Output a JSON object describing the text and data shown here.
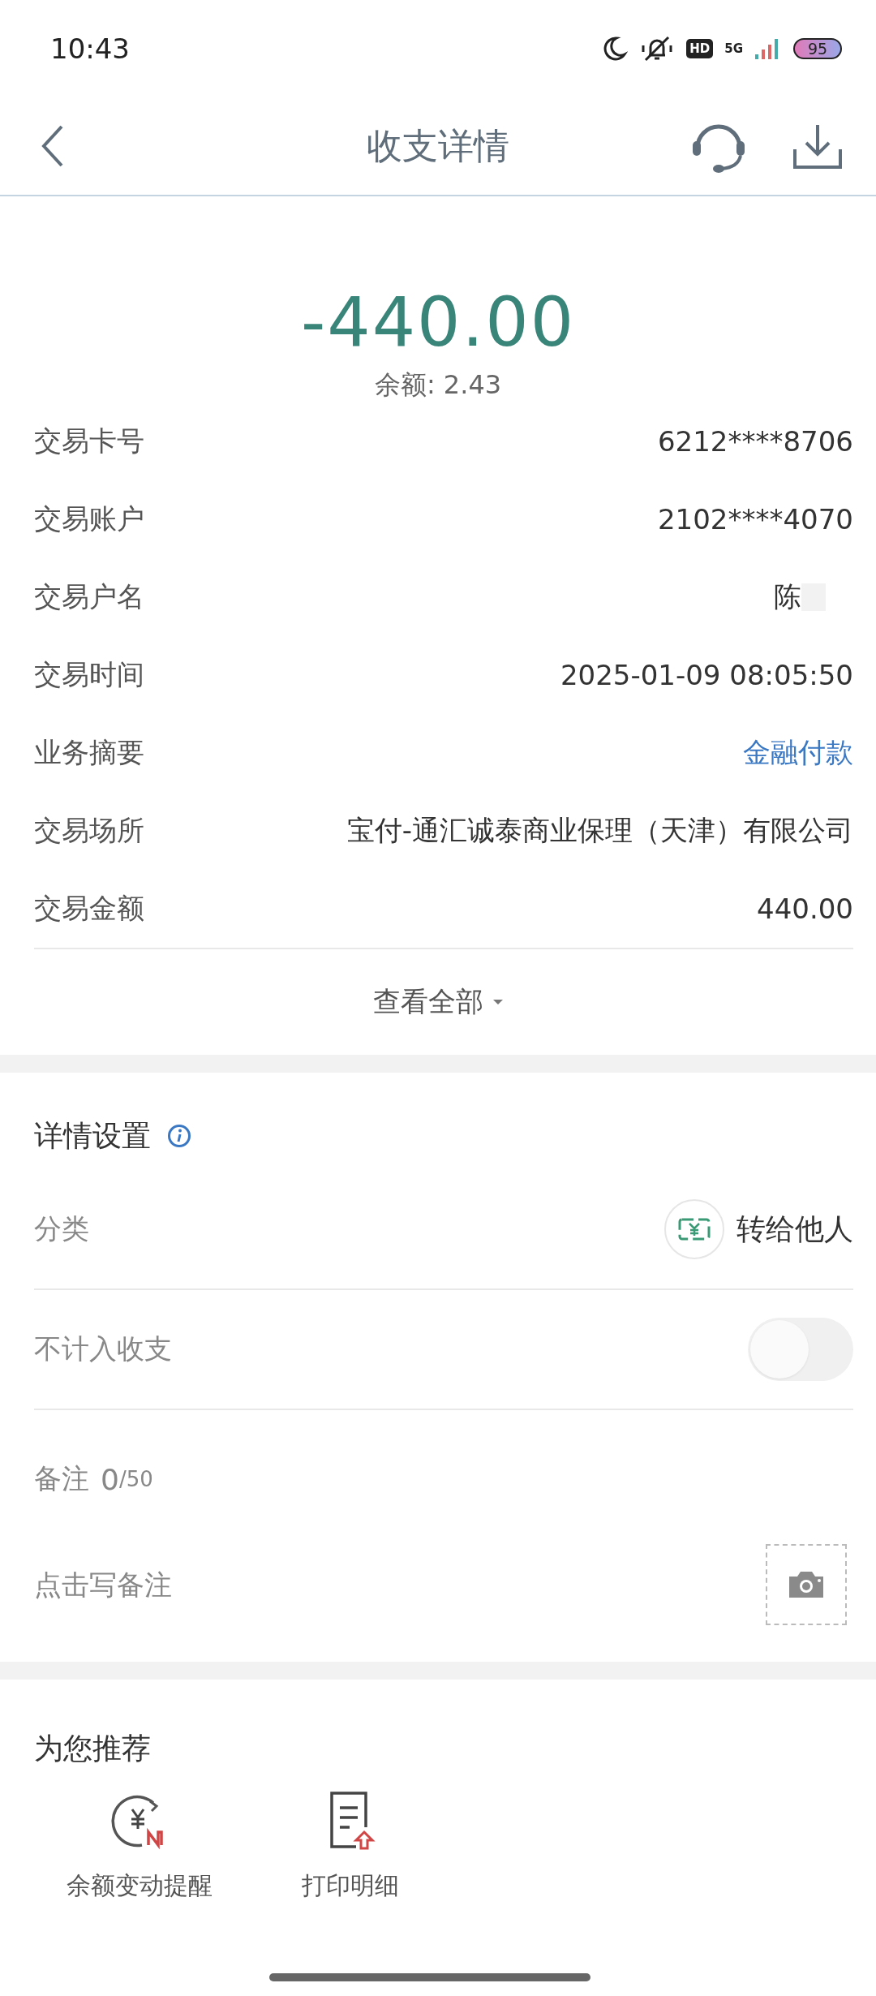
{
  "status_bar": {
    "time": "10:43",
    "hd_badge": "HD",
    "network": "5G",
    "battery": "95"
  },
  "header": {
    "title": "收支详情"
  },
  "summary": {
    "amount": "-440.00",
    "balance": "余额: 2.43"
  },
  "details": [
    {
      "label": "交易卡号",
      "value": "6212****8706",
      "kind": "text"
    },
    {
      "label": "交易账户",
      "value": "2102****4070",
      "kind": "text"
    },
    {
      "label": "交易户名",
      "value": "陈",
      "kind": "redacted"
    },
    {
      "label": "交易时间",
      "value": "2025-01-09 08:05:50",
      "kind": "text"
    },
    {
      "label": "业务摘要",
      "value": "金融付款",
      "kind": "link"
    },
    {
      "label": "交易场所",
      "value": "宝付-通汇诚泰商业保理（天津）有限公司",
      "kind": "text"
    },
    {
      "label": "交易金额",
      "value": "440.00",
      "kind": "text"
    }
  ],
  "expand": {
    "label": "查看全部"
  },
  "settings": {
    "title": "详情设置",
    "category": {
      "label": "分类",
      "value": "转给他人"
    },
    "exclude": {
      "label": "不计入收支",
      "on": false
    },
    "note": {
      "label": "备注",
      "count": "0",
      "limit": "/50",
      "placeholder": "点击写备注"
    }
  },
  "recommend": {
    "title": "为您推荐",
    "items": [
      {
        "label": "余额变动提醒",
        "kind": "alert"
      },
      {
        "label": "打印明细",
        "kind": "print"
      }
    ]
  }
}
